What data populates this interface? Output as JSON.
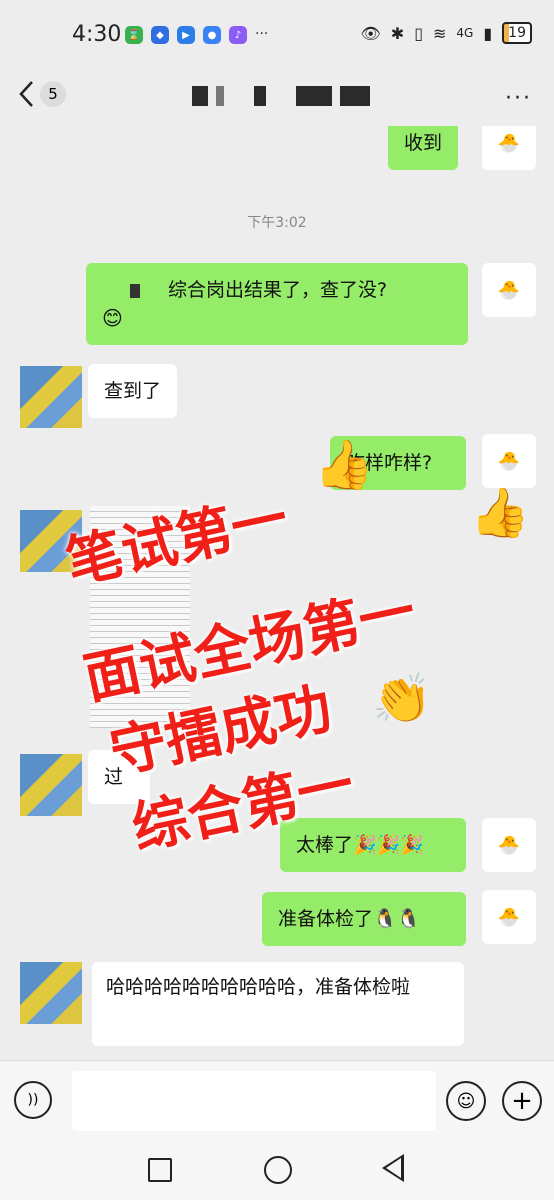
{
  "status": {
    "time": "4:30",
    "network": "4G",
    "battery": "19"
  },
  "header": {
    "back_count": "5",
    "more": "···"
  },
  "chat": {
    "time_label": "下午3:02",
    "messages": [
      {
        "from": "self",
        "text": "收到"
      },
      {
        "from": "self",
        "text": "综合岗出结果了，查了没?"
      },
      {
        "from": "other",
        "text": "查到了"
      },
      {
        "from": "self",
        "text": "咋样咋样?"
      },
      {
        "from": "other",
        "text": "过"
      },
      {
        "from": "self",
        "text": "太棒了🎉🎉🎉"
      },
      {
        "from": "self",
        "text": "准备体检了🐧🐧"
      },
      {
        "from": "other",
        "text": "哈哈哈哈哈哈哈哈哈哈，准备体检啦"
      }
    ]
  },
  "overlay": {
    "line1": "笔试第一",
    "line2": "面试全场第一",
    "line3": "守擂成功",
    "line4": "综合第一"
  },
  "colors": {
    "bubble_self": "#95ec69",
    "bubble_other": "#ffffff",
    "overlay_text": "#f02018",
    "background": "#ededed"
  }
}
